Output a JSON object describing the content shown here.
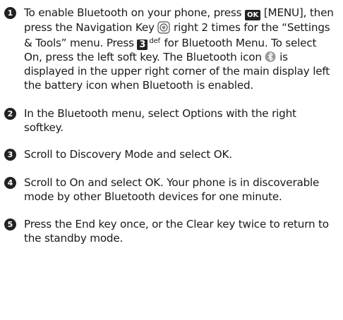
{
  "steps": [
    {
      "number": "1",
      "parts": {
        "a": "To enable Bluetooth on your phone, press ",
        "ok_key": "OK",
        "b": " [MENU], then press the Navigation Key ",
        "c": " right 2 times for the “Settings & Tools” menu. Press ",
        "key_3": "3",
        "key_3_sub": "def",
        "d": " for Bluetooth Menu. To select On, press the left soft key. The Bluetooth icon ",
        "e": " is displayed in the upper right corner of the main display left the battery icon when Bluetooth is enabled."
      }
    },
    {
      "number": "2",
      "text": "In the Bluetooth menu, select Options with the right softkey."
    },
    {
      "number": "3",
      "text": "Scroll to Discovery Mode and select OK."
    },
    {
      "number": "4",
      "text": "Scroll to On and select OK. Your phone is in discoverable mode by other Bluetooth devices for one minute."
    },
    {
      "number": "5",
      "text": "Press the End key once, or the Clear key twice to return to the standby mode."
    }
  ],
  "icons": {
    "ok_key": "ok-key-icon",
    "nav_key": "navigation-key-icon",
    "key_3": "key-3-def-icon",
    "bluetooth": "bluetooth-icon"
  }
}
